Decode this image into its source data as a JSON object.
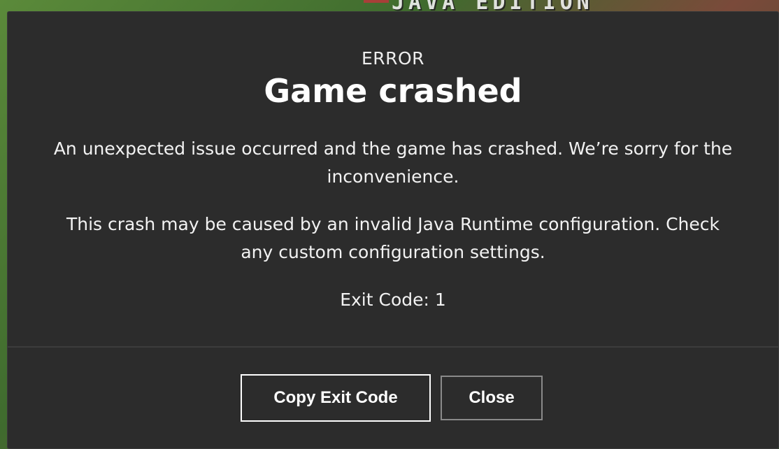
{
  "background": {
    "logo_text": "JAVA EDITION"
  },
  "dialog": {
    "kicker": "ERROR",
    "title": "Game crashed",
    "paragraph_1": "An unexpected issue occurred and the game has crashed. We’re sorry for the inconvenience.",
    "paragraph_2": "This crash may be caused by an invalid Java Runtime configuration. Check any custom configuration settings.",
    "exit_code": "Exit Code: 1"
  },
  "buttons": {
    "copy_exit_code": "Copy Exit Code",
    "close": "Close"
  },
  "colors": {
    "dialog_bg": "#2c2c2c",
    "text": "#ffffff",
    "primary_border": "#ffffff",
    "secondary_border": "#8a8a8a"
  }
}
